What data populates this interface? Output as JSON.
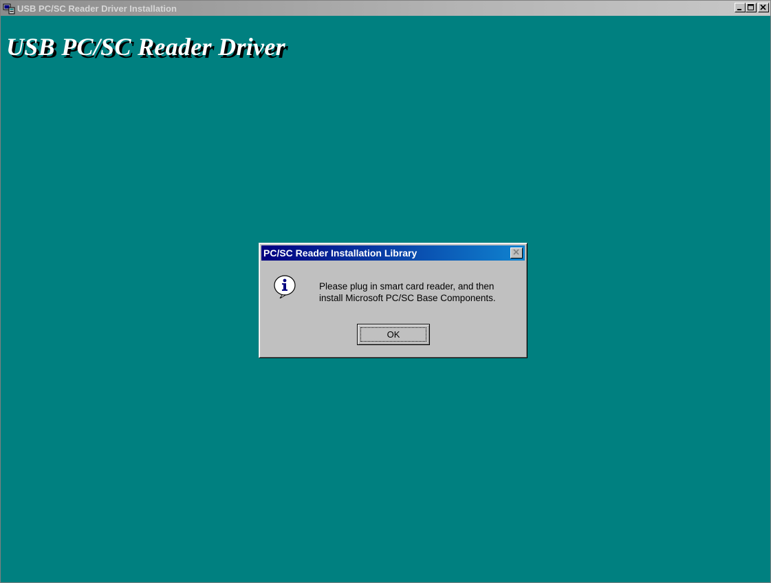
{
  "main_window": {
    "title": "USB PC/SC Reader Driver Installation",
    "banner_title": "USB PC/SC Reader Driver",
    "background_color": "#008080",
    "title_icon": "computer-setup-icon",
    "buttons": {
      "minimize_icon": "minimize-icon",
      "maximize_icon": "maximize-icon",
      "close_icon": "close-icon"
    }
  },
  "dialog": {
    "title": "PC/SC Reader Installation Library",
    "icon": "info-icon",
    "message_lines": [
      "Please plug in smart card reader, and then",
      "install Microsoft PC/SC Base Components."
    ],
    "ok_label": "OK",
    "title_color": "#000080"
  }
}
